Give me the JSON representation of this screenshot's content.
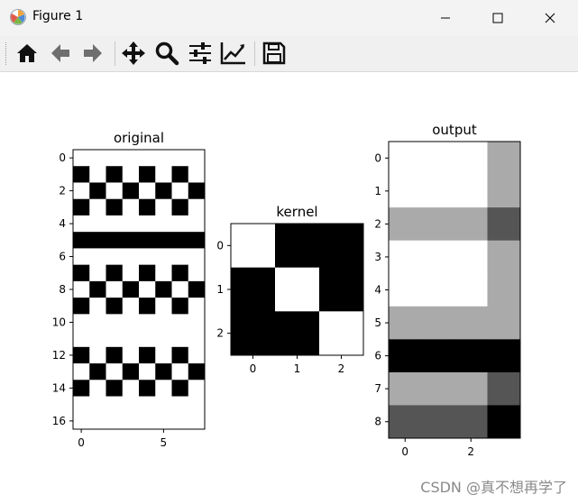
{
  "window": {
    "title": "Figure 1",
    "controls": [
      "minimize-icon",
      "maximize-icon",
      "close-icon"
    ]
  },
  "toolbar": {
    "tools": [
      "home-icon",
      "back-arrow-icon",
      "forward-arrow-icon",
      "pan-icon",
      "zoom-icon",
      "configure-subplots-icon",
      "edit-axis-icon",
      "save-icon"
    ]
  },
  "chart_data": [
    {
      "type": "heatmap",
      "title": "original",
      "rows": 17,
      "cols": 8,
      "colormap": "gray",
      "xticks": [
        0,
        5
      ],
      "yticks": [
        0,
        2,
        4,
        6,
        8,
        10,
        12,
        14,
        16
      ],
      "values": [
        [
          1,
          1,
          1,
          1,
          1,
          1,
          1,
          1
        ],
        [
          0,
          1,
          0,
          1,
          0,
          1,
          0,
          1
        ],
        [
          1,
          0,
          1,
          0,
          1,
          0,
          1,
          0
        ],
        [
          0,
          1,
          0,
          1,
          0,
          1,
          0,
          1
        ],
        [
          1,
          1,
          1,
          1,
          1,
          1,
          1,
          1
        ],
        [
          0,
          0,
          0,
          0,
          0,
          0,
          0,
          0
        ],
        [
          1,
          1,
          1,
          1,
          1,
          1,
          1,
          1
        ],
        [
          0,
          1,
          0,
          1,
          0,
          1,
          0,
          1
        ],
        [
          1,
          0,
          1,
          0,
          1,
          0,
          1,
          0
        ],
        [
          0,
          1,
          0,
          1,
          0,
          1,
          0,
          1
        ],
        [
          1,
          1,
          1,
          1,
          1,
          1,
          1,
          1
        ],
        [
          1,
          1,
          1,
          1,
          1,
          1,
          1,
          1
        ],
        [
          0,
          1,
          0,
          1,
          0,
          1,
          0,
          1
        ],
        [
          1,
          0,
          1,
          0,
          1,
          0,
          1,
          0
        ],
        [
          0,
          1,
          0,
          1,
          0,
          1,
          0,
          1
        ],
        [
          1,
          1,
          1,
          1,
          1,
          1,
          1,
          1
        ],
        [
          1,
          1,
          1,
          1,
          1,
          1,
          1,
          1
        ]
      ]
    },
    {
      "type": "heatmap",
      "title": "kernel",
      "rows": 3,
      "cols": 3,
      "colormap": "gray",
      "xticks": [
        0,
        1,
        2
      ],
      "yticks": [
        0,
        1,
        2
      ],
      "values": [
        [
          1,
          0,
          0
        ],
        [
          0,
          1,
          0
        ],
        [
          0,
          0,
          1
        ]
      ]
    },
    {
      "type": "heatmap",
      "title": "output",
      "rows": 9,
      "cols": 4,
      "colormap": "gray",
      "xticks": [
        0,
        2
      ],
      "yticks": [
        0,
        1,
        2,
        3,
        4,
        5,
        6,
        7,
        8
      ],
      "values": [
        [
          1,
          1,
          1,
          0.667
        ],
        [
          1,
          1,
          1,
          0.667
        ],
        [
          0.667,
          0.667,
          0.667,
          0.333
        ],
        [
          1,
          1,
          1,
          0.667
        ],
        [
          1,
          1,
          1,
          0.667
        ],
        [
          0.667,
          0.667,
          0.667,
          0.667
        ],
        [
          0,
          0,
          0,
          0
        ],
        [
          0.667,
          0.667,
          0.667,
          0.333
        ],
        [
          0.333,
          0.333,
          0.333,
          0
        ]
      ]
    }
  ],
  "watermark": "CSDN @真不想再学了"
}
